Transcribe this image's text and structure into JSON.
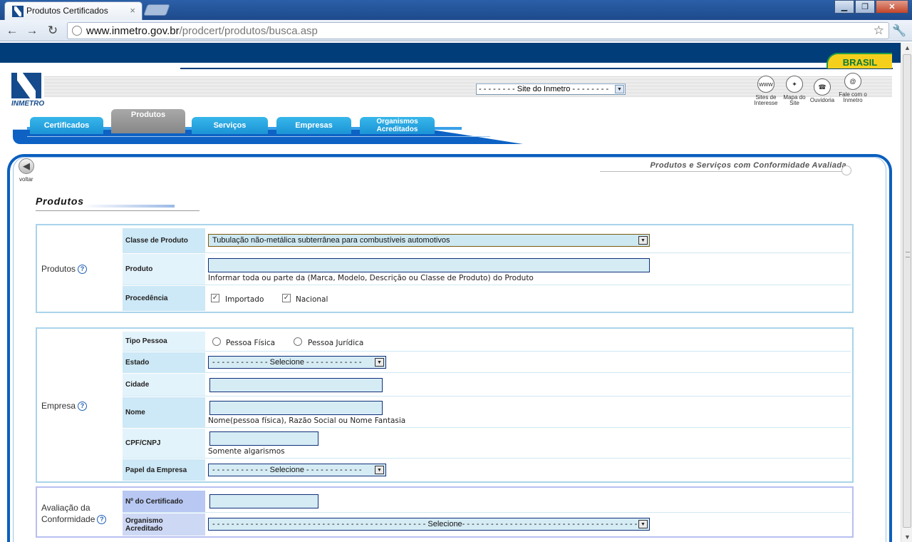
{
  "browser": {
    "tab_title": "Produtos Certificados",
    "tab_close": "×",
    "url_host": "www.inmetro.gov.br",
    "url_path": "/prodcert/produtos/busca.asp",
    "back_glyph": "←",
    "forward_glyph": "→",
    "reload_glyph": "↻",
    "star_glyph": "☆",
    "wrench_glyph": "🔧",
    "minimize_glyph": "▁",
    "maximize_glyph": "❐",
    "close_glyph": "✕"
  },
  "header": {
    "brasil_label": "BRASIL",
    "logo_text": "INMETRO",
    "site_select": "- - - - - - - - Site do Inmetro - - - - - - - -",
    "icons": [
      {
        "label": "Sites de Interesse",
        "glyph": "www"
      },
      {
        "label": "Mapa do Site",
        "glyph": "✦"
      },
      {
        "label": "Ouvidoria",
        "glyph": "☎"
      },
      {
        "label": "Fale com o Inmetro",
        "glyph": "@"
      }
    ]
  },
  "nav": {
    "tabs": [
      "Certificados",
      "Produtos",
      "Serviços",
      "Empresas",
      "Organismos Acreditados"
    ],
    "active": "Produtos"
  },
  "page": {
    "voltar": "voltar",
    "voltar_glyph": "◀",
    "subtitle": "Produtos e Serviços com Conformidade Avaliada",
    "section_title": "Produtos"
  },
  "form": {
    "produtos": {
      "label": "Produtos",
      "classe_label": "Classe de Produto",
      "classe_value": "Tubulação não-metálica subterrânea para combustíveis automotivos",
      "produto_label": "Produto",
      "produto_value": "",
      "produto_hint": "Informar toda ou parte da (Marca, Modelo, Descrição ou Classe de Produto) do Produto",
      "procedencia_label": "Procedência",
      "importado": "Importado",
      "nacional": "Nacional"
    },
    "empresa": {
      "label": "Empresa",
      "tipo_label": "Tipo Pessoa",
      "fisica": "Pessoa Física",
      "juridica": "Pessoa Jurídica",
      "estado_label": "Estado",
      "estado_value": "- - - - - - - - - - - - Selecione - - - - - - - - - - - -",
      "cidade_label": "Cidade",
      "nome_label": "Nome",
      "nome_hint": "Nome(pessoa física), Razão Social ou Nome Fantasia",
      "cpf_label": "CPF/CNPJ",
      "cpf_hint": "Somente algarismos",
      "papel_label": "Papel da Empresa",
      "papel_value": "- - - - - - - - - - - - Selecione - - - - - - - - - - - -"
    },
    "avaliacao": {
      "label_line1": "Avaliação da",
      "label_line2": "Conformidade",
      "certificado_label": "Nº do Certificado",
      "organismo_label_line1": "Organismo",
      "organismo_label_line2": "Acreditado",
      "organismo_value": "- - - - - - - - - - - - - - - - - - - - - - - - - - - - - - - - - - - - - - - - - - - - - Selecione- - - - - - - - - - - - - - - - - - - - - - - - - - - - - - - - - - - - - - - - - - - - -"
    },
    "help_glyph": "?",
    "check_glyph": "✓",
    "dropdown_glyph": "▼"
  }
}
